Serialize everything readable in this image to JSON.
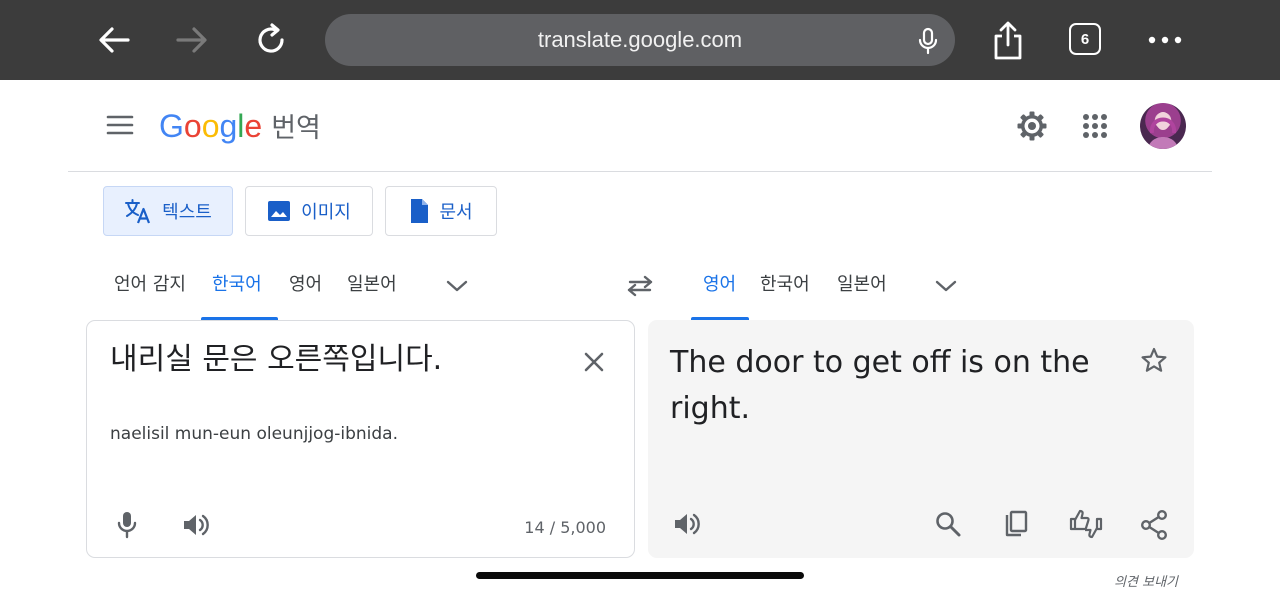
{
  "browser": {
    "url": "translate.google.com",
    "tab_count": "6",
    "icons": [
      "back-arrow-icon",
      "forward-arrow-icon",
      "reload-icon",
      "microphone-icon",
      "share-icon",
      "tabs-icon",
      "more-icon"
    ]
  },
  "header": {
    "logo_letters": [
      {
        "ch": "G",
        "color": "#4285f4"
      },
      {
        "ch": "o",
        "color": "#ea4335"
      },
      {
        "ch": "o",
        "color": "#fbbc05"
      },
      {
        "ch": "g",
        "color": "#4285f4"
      },
      {
        "ch": "l",
        "color": "#34a853"
      },
      {
        "ch": "e",
        "color": "#ea4335"
      }
    ],
    "product_name": "번역"
  },
  "modes": [
    {
      "label": "텍스트",
      "active": true,
      "icon": "translate-icon"
    },
    {
      "label": "이미지",
      "active": false,
      "icon": "image-icon"
    },
    {
      "label": "문서",
      "active": false,
      "icon": "document-icon"
    }
  ],
  "source_languages": [
    "언어 감지",
    "한국어",
    "영어",
    "일본어"
  ],
  "source_active_index": 1,
  "target_languages": [
    "영어",
    "한국어",
    "일본어"
  ],
  "target_active_index": 0,
  "source": {
    "text": "내리실 문은 오른쪽입니다.",
    "romanization": "naelisil mun-eun oleunjjog-ibnida.",
    "char_count": "14 / 5,000"
  },
  "target": {
    "text": "The door to get off is on the right."
  },
  "feedback_label": "의견 보내기",
  "colors": {
    "accent": "#1a73e8",
    "chrome_bg": "#3c3c3c",
    "target_panel_bg": "#f5f5f5"
  }
}
